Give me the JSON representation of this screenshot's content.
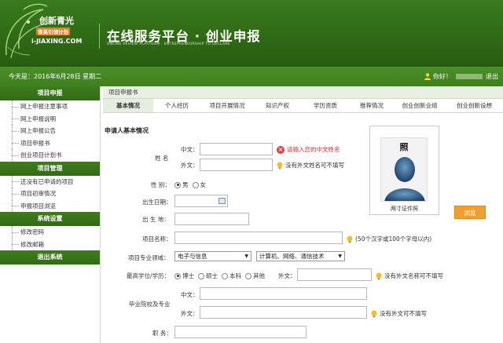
{
  "header": {
    "logo_title": "创新青光",
    "logo_subtitle": "青英引领计划",
    "logo_domain": "i-JIAXING.COM",
    "platform_title": "在线服务平台 · 创业申报",
    "platform_subtitle": "ONLINE REVIEW PLATFORM · ENTREPRENEURSHIP TO DECLARE"
  },
  "statusbar": {
    "today_text": "今天是：2016年6月28日  星期二",
    "greeting": "你好！",
    "logout": "退出"
  },
  "sidebar": {
    "sections": [
      {
        "title": "项目申报",
        "items": [
          "网上申报注意事项",
          "网上申报说明",
          "网上申报公告",
          "项目申报书",
          "创业项目计划书"
        ]
      },
      {
        "title": "项目管理",
        "items": [
          "还没有已申请的项目",
          "项目初审情况",
          "申报项目浏览"
        ]
      },
      {
        "title": "系统设置",
        "items": [
          "修改密码",
          "修改邮箱"
        ]
      },
      {
        "title": "退出系统",
        "items": []
      }
    ]
  },
  "main": {
    "title": "项目申报书",
    "tabs": [
      "基本情况",
      "个人经历",
      "项目开展情况",
      "知识产权",
      "学历资质",
      "推荐情况",
      "创业创新业绩",
      "创业创新设想"
    ],
    "section_title": "申请人基本情况"
  },
  "form": {
    "name_label": "姓 名",
    "cn_label": "中文：",
    "en_label": "外文：",
    "name_error": "请输入您的中文姓名",
    "name_en_hint": "没有外文姓名可不填写",
    "gender_label": "性 别：",
    "gender_male": "男",
    "gender_female": "女",
    "birthdate_label": "出生日期：",
    "birthplace_label": "出 生 地：",
    "project_label": "项目名称：",
    "project_hint": "(50个汉字或100个字母以内)",
    "field_label": "项目专业领域：",
    "field_select1": "电子与信息",
    "field_select2": "计算机、网络、通信技术",
    "degree_label": "最高学位/学历：",
    "degree_options": [
      "博士",
      "硕士",
      "本科",
      "其他"
    ],
    "degree_en_label": "外文：",
    "degree_en_hint": "没有外文名称可不填写",
    "school_label": "毕业院校及专业",
    "school_cn_label": "中文：",
    "school_en_label": "外文：",
    "school_en_hint": "没有外文可不填写",
    "title_label": "职 务："
  },
  "photo": {
    "stamp": "照",
    "caption": "两寸证件照",
    "browse": "浏览"
  },
  "colors": {
    "header_green": "#2f6a15",
    "status_green": "#4a8f28",
    "error_red": "#d03030",
    "browse_orange": "#f0a030"
  }
}
